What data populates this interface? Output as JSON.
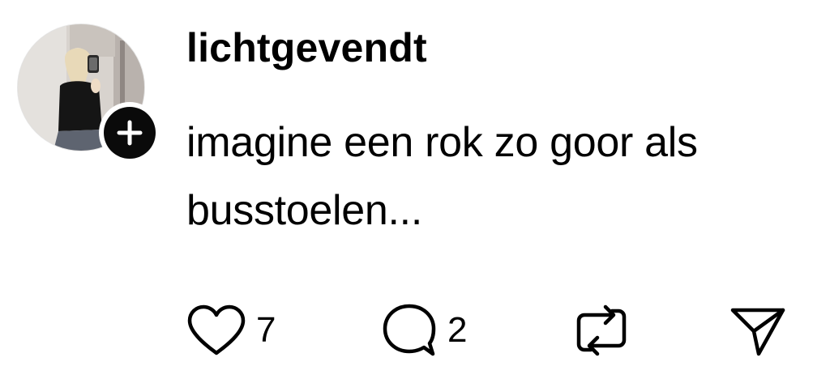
{
  "post": {
    "username": "lichtgevendt",
    "text": "imagine een rok zo goor als busstoelen...",
    "avatar": {
      "icon": "profile-photo",
      "follow_icon": "plus-icon"
    },
    "actions": {
      "like": {
        "icon": "heart-icon",
        "count": "7"
      },
      "reply": {
        "icon": "speech-bubble-icon",
        "count": "2"
      },
      "repost": {
        "icon": "repost-icon"
      },
      "share": {
        "icon": "send-icon"
      }
    }
  },
  "colors": {
    "text": "#000000",
    "background": "#ffffff",
    "follow_badge": "#0a0a0a"
  }
}
